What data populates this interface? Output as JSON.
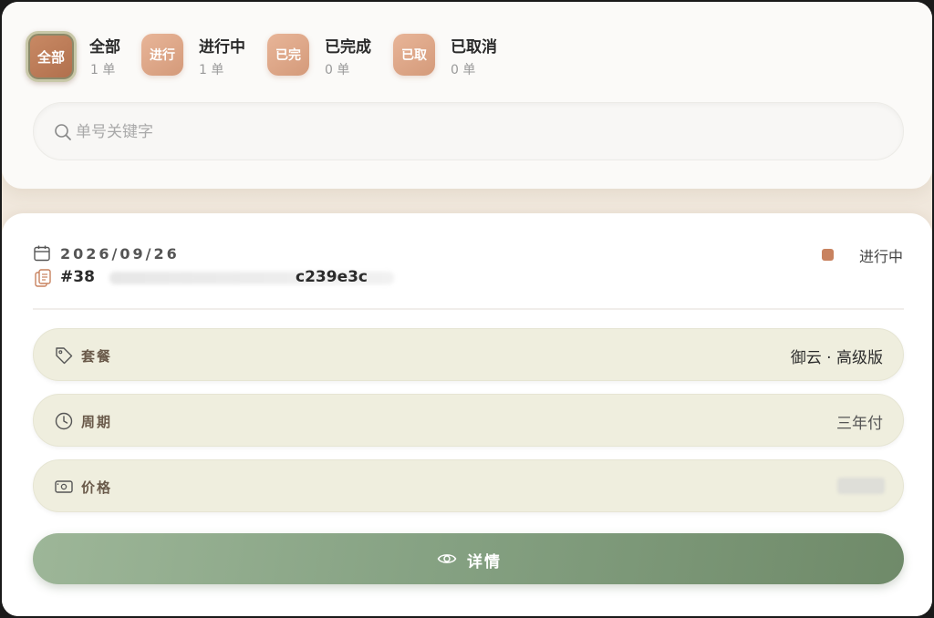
{
  "filters": [
    {
      "badge": "全部",
      "name": "全部",
      "count": "1 单",
      "active": true
    },
    {
      "badge": "进行",
      "name": "进行中",
      "count": "1 单",
      "active": false
    },
    {
      "badge": "已完",
      "name": "已完成",
      "count": "0 单",
      "active": false
    },
    {
      "badge": "已取",
      "name": "已取消",
      "count": "0 单",
      "active": false
    }
  ],
  "search": {
    "placeholder": "单号关键字",
    "value": ""
  },
  "order": {
    "date": "2026/09/26",
    "id_prefix": "#38",
    "id_suffix": "c239e3c",
    "status_label": "进行中",
    "status_color": "#c8825f",
    "rows": [
      {
        "icon": "tag-icon",
        "label": "套餐",
        "value": "御云 · 高级版"
      },
      {
        "icon": "clock-icon",
        "label": "周期",
        "value": "三年付"
      },
      {
        "icon": "wallet-icon",
        "label": "价格",
        "value": ""
      }
    ],
    "detail_button": "详情"
  },
  "colors": {
    "accent": "#c98a65",
    "row_bg": "#efeede",
    "button_green": "#86a283"
  }
}
